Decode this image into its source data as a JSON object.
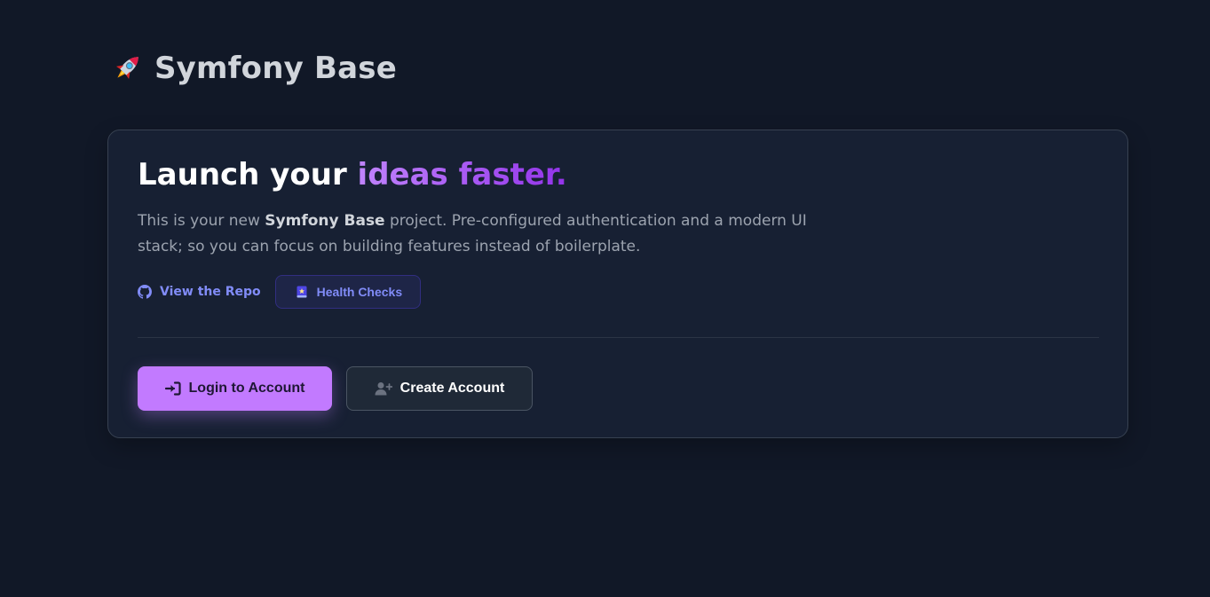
{
  "header": {
    "title": "Symfony Base",
    "icon": "rocket-icon"
  },
  "hero": {
    "heading_plain": "Launch your ",
    "heading_accent": "ideas faster.",
    "description_prefix": "This is your new ",
    "description_bold": "Symfony Base",
    "description_suffix": " project. Pre-configured authentication and a modern UI stack; so you can focus on building features instead of boilerplate.",
    "repo_link": {
      "label": "View the Repo",
      "icon": "github-icon"
    },
    "health_button": {
      "label": "Health Checks",
      "icon": "book-icon"
    }
  },
  "actions": {
    "login": {
      "label": "Login to Account",
      "icon": "login-arrow-icon"
    },
    "register": {
      "label": "Create Account",
      "icon": "user-plus-icon"
    }
  },
  "colors": {
    "background": "#111827",
    "card": "#172033",
    "accent": "#a855f7",
    "link": "#818cf8",
    "primary_button": "#c27aff"
  }
}
